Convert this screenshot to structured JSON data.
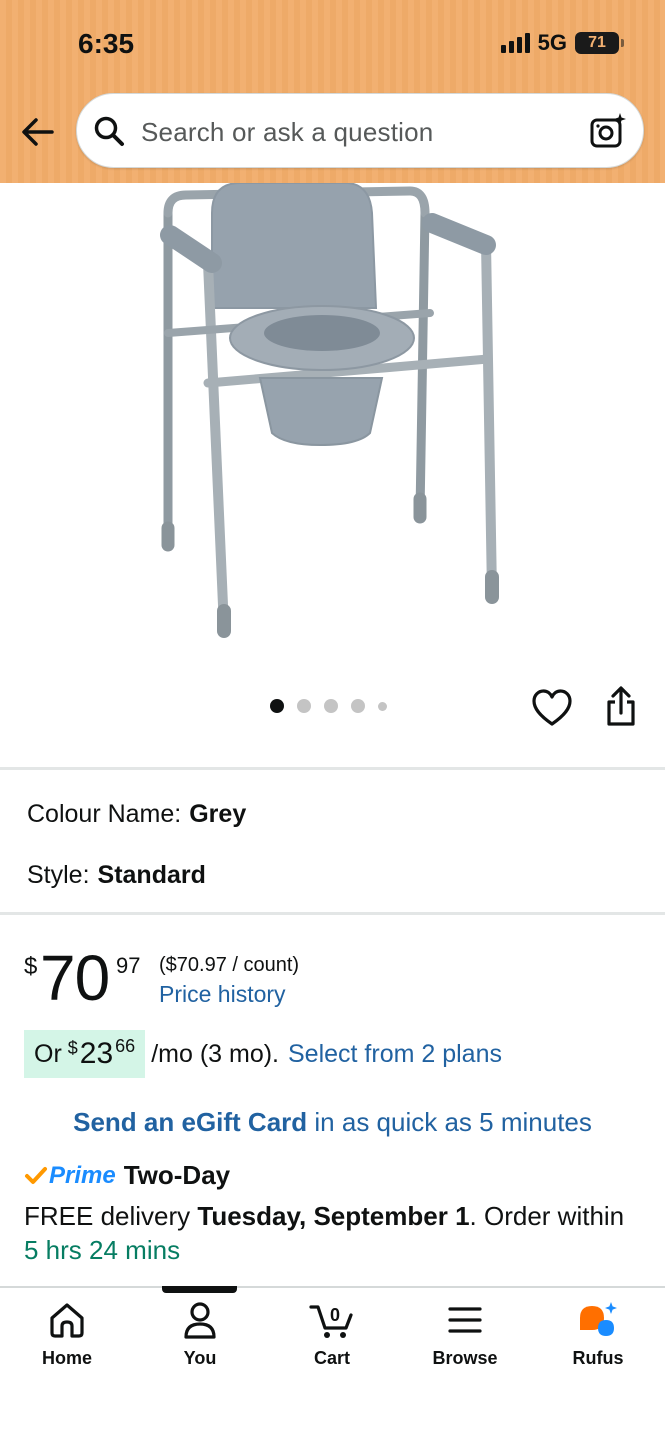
{
  "status_bar": {
    "time": "6:35",
    "network": "5G",
    "battery": "71"
  },
  "search": {
    "placeholder": "Search or ask a question"
  },
  "gallery": {
    "image_count": 5,
    "active_index": 0
  },
  "variations": {
    "colour_label": "Colour Name:",
    "colour_value": "Grey",
    "style_label": "Style:",
    "style_value": "Standard"
  },
  "price": {
    "currency": "$",
    "whole": "70",
    "fraction": "97",
    "unit_price": "($70.97 / count)",
    "history_link": "Price history"
  },
  "installment": {
    "prefix": "Or",
    "currency": "$",
    "amount": "23",
    "cents": "66",
    "term": "/mo (3 mo).",
    "link": "Select from 2 plans"
  },
  "egift": {
    "bold": "Send an eGift Card",
    "rest": "in as quick as 5 minutes"
  },
  "delivery": {
    "prime": "Prime",
    "speed": "Two-Day",
    "free_text": "FREE delivery",
    "date": "Tuesday, September 1",
    "order_text": ". Order within",
    "countdown": "5 hrs 24 mins"
  },
  "bottom_nav": {
    "home": "Home",
    "you": "You",
    "cart": "Cart",
    "cart_count": "0",
    "browse": "Browse",
    "rufus": "Rufus"
  },
  "colors": {
    "header_bg": "#f2b071",
    "link": "#2162a1",
    "installment_bg": "#d4f5e7",
    "countdown": "#067d62",
    "prime": "#1a8cff",
    "prime_check": "#ff9900",
    "rufus_orange": "#ff6f00",
    "rufus_blue": "#1a8cff"
  }
}
